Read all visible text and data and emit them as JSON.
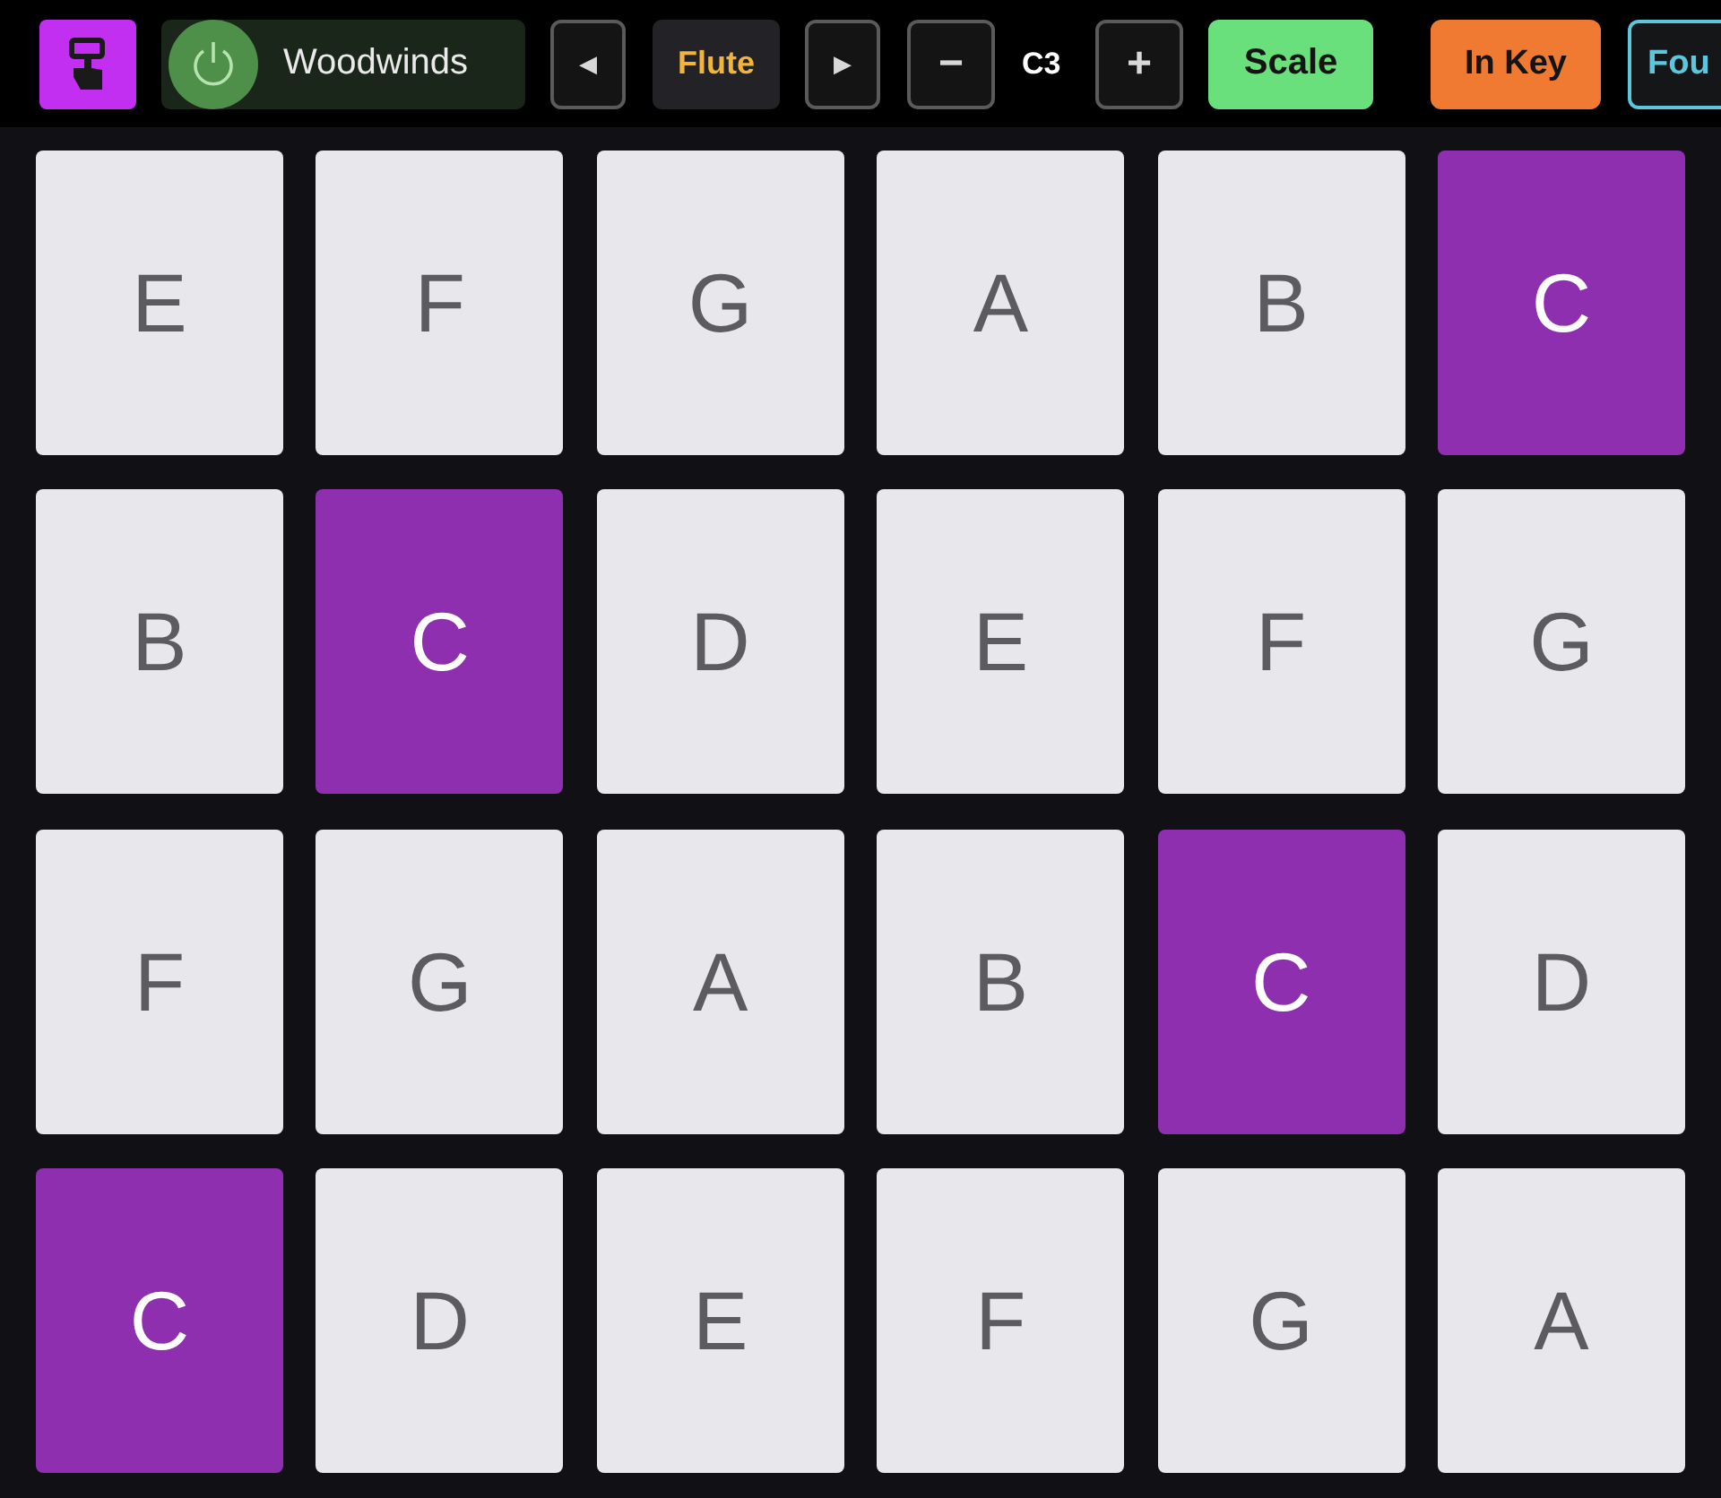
{
  "toolbar": {
    "group": {
      "label": "Woodwinds",
      "power_on": true
    },
    "instrument": {
      "prev": "◀",
      "label": "Flute",
      "next": "▶"
    },
    "octave": {
      "down": "−",
      "label": "C3",
      "up": "+"
    },
    "modes": [
      {
        "label": "Scale",
        "on": true,
        "color": "#6ae07c"
      },
      {
        "label": "In Key",
        "on": true,
        "color": "#f07a32"
      },
      {
        "label": "Fou",
        "on": false,
        "color": "#5cc6dc"
      }
    ]
  },
  "pads": [
    {
      "note": "E",
      "root": false
    },
    {
      "note": "F",
      "root": false
    },
    {
      "note": "G",
      "root": false
    },
    {
      "note": "A",
      "root": false
    },
    {
      "note": "B",
      "root": false
    },
    {
      "note": "C",
      "root": true
    },
    {
      "note": "B",
      "root": false
    },
    {
      "note": "C",
      "root": true
    },
    {
      "note": "D",
      "root": false
    },
    {
      "note": "E",
      "root": false
    },
    {
      "note": "F",
      "root": false
    },
    {
      "note": "G",
      "root": false
    },
    {
      "note": "F",
      "root": false
    },
    {
      "note": "G",
      "root": false
    },
    {
      "note": "A",
      "root": false
    },
    {
      "note": "B",
      "root": false
    },
    {
      "note": "C",
      "root": true
    },
    {
      "note": "D",
      "root": false
    },
    {
      "note": "C",
      "root": true
    },
    {
      "note": "D",
      "root": false
    },
    {
      "note": "E",
      "root": false
    },
    {
      "note": "F",
      "root": false
    },
    {
      "note": "G",
      "root": false
    },
    {
      "note": "A",
      "root": false
    }
  ]
}
